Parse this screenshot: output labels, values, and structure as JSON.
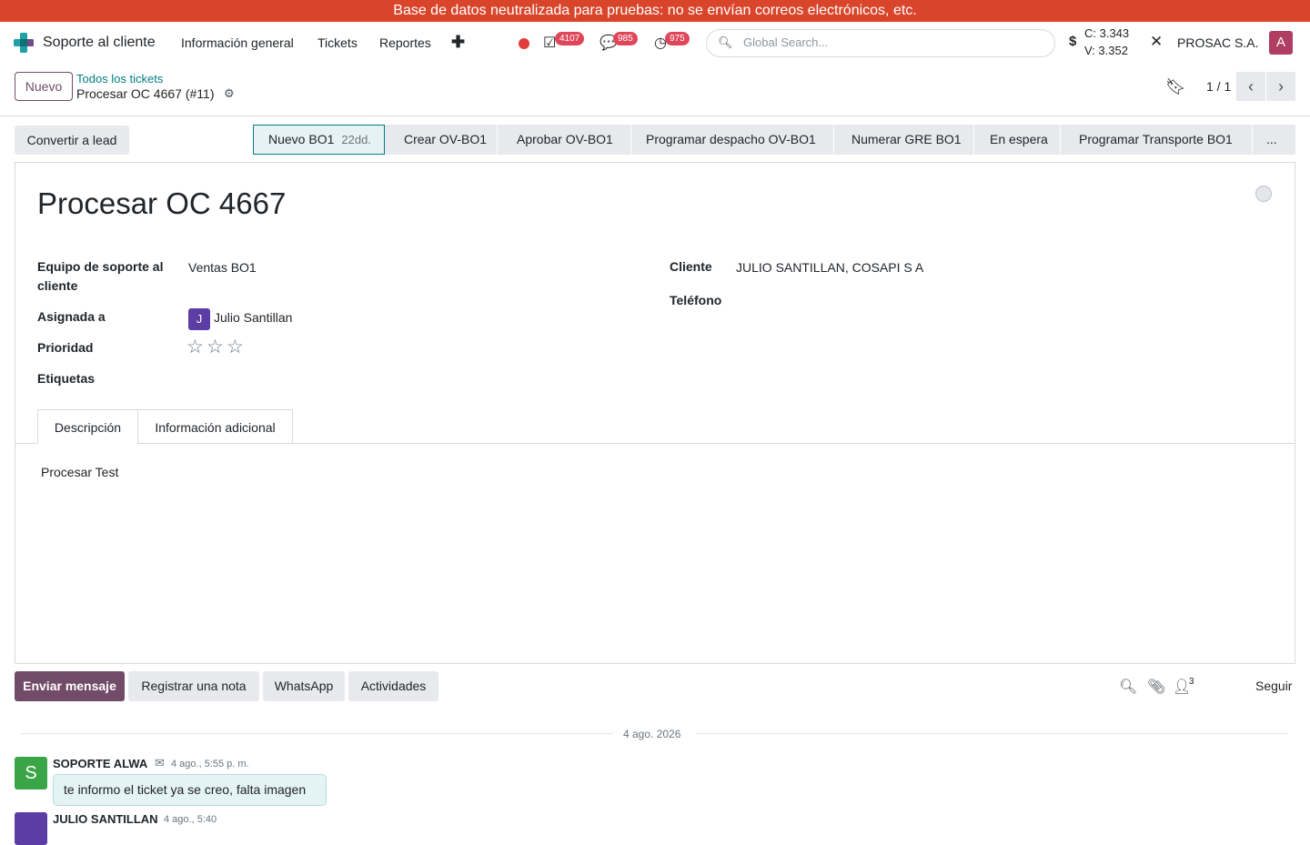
{
  "banner": "Base de datos neutralizada para pruebas: no se envían correos electrónicos, etc.",
  "topnav": {
    "app_name": "Soporte al cliente",
    "items": [
      "Información general",
      "Tickets",
      "Reportes"
    ],
    "activity_badge": "4107",
    "messages_badge": "985",
    "clock_badge": "975",
    "search_placeholder": "Global Search...",
    "rate_c": "C: 3.343",
    "rate_v": "V: 3.352",
    "company": "PROSAC S.A.",
    "user_initial": "A"
  },
  "control": {
    "new_label": "Nuevo",
    "breadcrumb": "Todos los tickets",
    "record": "Procesar OC 4667 (#11)",
    "pager": "1 / 1"
  },
  "statusbar": {
    "convert_label": "Convertir a lead",
    "stages": [
      "Nuevo BO1",
      "Crear OV-BO1",
      "Aprobar OV-BO1",
      "Programar despacho OV-BO1",
      "Numerar GRE BO1",
      "En espera",
      "Programar Transporte BO1",
      "..."
    ],
    "active_days": "22dd."
  },
  "form": {
    "title": "Procesar OC 4667",
    "team_label_1": "Equipo de soporte al",
    "team_label_2": "cliente",
    "team_value": "Ventas BO1",
    "assigned_label": "Asignada a",
    "assigned_initial": "J",
    "assigned_value": "Julio Santillan",
    "priority_label": "Prioridad",
    "priority_stars": 0,
    "tags_label": "Etiquetas",
    "customer_label": "Cliente",
    "customer_value": "JULIO SANTILLAN, COSAPI S A",
    "phone_label": "Teléfono",
    "tabs": [
      "Descripción",
      "Información adicional"
    ],
    "description": "Procesar Test"
  },
  "chatter": {
    "send_label": "Enviar mensaje",
    "note_label": "Registrar una nota",
    "whatsapp_label": "WhatsApp",
    "activities_label": "Actividades",
    "followers_count": "3",
    "follow_label": "Seguir",
    "date": "4 ago. 2026",
    "msg_avatar": "S",
    "msg_author": "SOPORTE ALWA",
    "msg_time": "4 ago., 5:55 p. m.",
    "msg_body": "te informo el ticket ya se creo, falta imagen",
    "msg2_author": "JULIO SANTILLAN",
    "msg2_time": "4 ago., 5:40"
  }
}
